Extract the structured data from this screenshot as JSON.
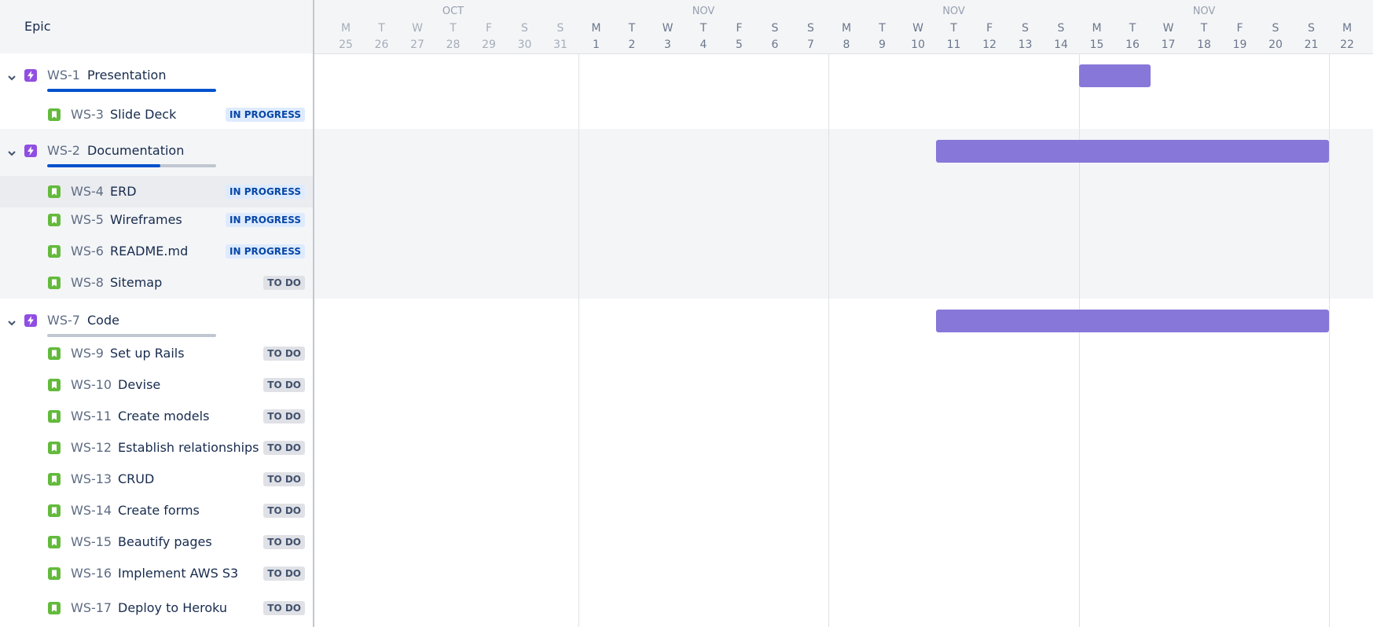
{
  "left_header": {
    "title": "Epic"
  },
  "rows": [
    {
      "type": "epic",
      "key": "WS-1",
      "summary": "Presentation",
      "progress_done": 1.0
    },
    {
      "type": "story",
      "key": "WS-3",
      "summary": "Slide Deck",
      "status": "IN PROGRESS"
    },
    {
      "type": "epic",
      "key": "WS-2",
      "summary": "Documentation",
      "progress_done": 0.67
    },
    {
      "type": "story",
      "key": "WS-4",
      "summary": "ERD",
      "status": "IN PROGRESS"
    },
    {
      "type": "story",
      "key": "WS-5",
      "summary": "Wireframes",
      "status": "IN PROGRESS"
    },
    {
      "type": "story",
      "key": "WS-6",
      "summary": "README.md",
      "status": "IN PROGRESS"
    },
    {
      "type": "story",
      "key": "WS-8",
      "summary": "Sitemap",
      "status": "TO DO"
    },
    {
      "type": "epic",
      "key": "WS-7",
      "summary": "Code",
      "progress_done": 0.0
    },
    {
      "type": "story",
      "key": "WS-9",
      "summary": "Set up Rails",
      "status": "TO DO"
    },
    {
      "type": "story",
      "key": "WS-10",
      "summary": "Devise",
      "status": "TO DO"
    },
    {
      "type": "story",
      "key": "WS-11",
      "summary": "Create models",
      "status": "TO DO"
    },
    {
      "type": "story",
      "key": "WS-12",
      "summary": "Establish relationships",
      "status": "TO DO"
    },
    {
      "type": "story",
      "key": "WS-13",
      "summary": "CRUD",
      "status": "TO DO"
    },
    {
      "type": "story",
      "key": "WS-14",
      "summary": "Create forms",
      "status": "TO DO"
    },
    {
      "type": "story",
      "key": "WS-15",
      "summary": "Beautify pages",
      "status": "TO DO"
    },
    {
      "type": "story",
      "key": "WS-16",
      "summary": "Implement AWS S3",
      "status": "TO DO"
    },
    {
      "type": "story",
      "key": "WS-17",
      "summary": "Deploy to Heroku",
      "status": "TO DO"
    }
  ],
  "timeline": {
    "months": [
      "OCT",
      "NOV",
      "NOV",
      "NOV"
    ],
    "weekday_letters": [
      "M",
      "T",
      "W",
      "T",
      "F",
      "S",
      "S",
      "M",
      "T",
      "W",
      "T",
      "F",
      "S",
      "S",
      "M",
      "T",
      "W",
      "T",
      "F",
      "S",
      "S",
      "M",
      "T",
      "W",
      "T",
      "F",
      "S",
      "S",
      "M"
    ],
    "day_numbers": [
      "25",
      "26",
      "27",
      "28",
      "29",
      "30",
      "31",
      "1",
      "2",
      "3",
      "4",
      "5",
      "6",
      "7",
      "8",
      "9",
      "10",
      "11",
      "12",
      "13",
      "14",
      "15",
      "16",
      "17",
      "18",
      "19",
      "20",
      "21",
      "22"
    ],
    "bars": [
      {
        "epic": "WS-1",
        "start": "Nov 15",
        "end": "Nov 16"
      },
      {
        "epic": "WS-2",
        "start": "Nov 11",
        "end": "Nov 21"
      },
      {
        "epic": "WS-7",
        "start": "Nov 11",
        "end": "Nov 21"
      }
    ]
  },
  "colors": {
    "bar": "#8777d9",
    "epic_icon": "#904ee2",
    "story_icon": "#63ba3c",
    "in_progress_bg": "#deebff",
    "in_progress_text": "#0747a6",
    "todo_bg": "#dfe1e6",
    "todo_text": "#42526e",
    "progress_fill": "#0052cc"
  },
  "icons": {
    "epic": "lightning-icon",
    "story": "bookmark-icon",
    "expand": "chevron-down-icon"
  }
}
